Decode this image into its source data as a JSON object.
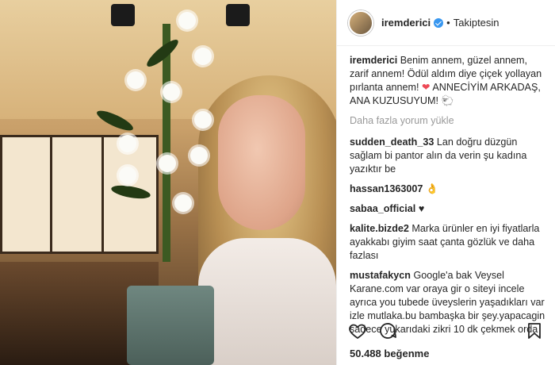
{
  "post": {
    "username": "iremderici",
    "follow_status": "Takiptesin",
    "likes": "50.488 beğenme",
    "load_more": "Daha fazla yorum yükle"
  },
  "caption": {
    "user": "iremderici",
    "text_part1": "Benim annem, güzel annem, zarif annem! Ödül aldım diye çiçek yollayan pırlanta annem! ",
    "emoji_heart": "❤",
    "text_part2": " ANNECİYİM ARKADAŞ, ANA KUZUSUYUM! 🐑"
  },
  "comments": [
    {
      "user": "sudden_death_33",
      "text": "Lan doğru düzgün sağlam bi pantor alın da verin şu kadına yazıktır be"
    },
    {
      "user": "hassan1363007",
      "text": "👌"
    },
    {
      "user": "sabaa_official",
      "text": "♥"
    },
    {
      "user": "kalite.bizde2",
      "text": "Marka ürünler en iyi fiyatlarla ayakkabı giyim saat çanta gözlük ve daha fazlası"
    },
    {
      "user": "mustafakycn",
      "text": "Google'a bak Veysel Karane.com var oraya gir o siteyi incele ayrıca you tubede üveyslerin yaşadıkları var izle mutlaka.bu bambaşka bir şey.yapacagin sadece yukarıdaki zikri 10 dk çekmek orda"
    }
  ],
  "icons": [
    "heart-icon",
    "comment-icon",
    "bookmark-icon",
    "verified-icon"
  ],
  "colors": {
    "verified": "#3897f0",
    "heart": "#ed4956"
  }
}
